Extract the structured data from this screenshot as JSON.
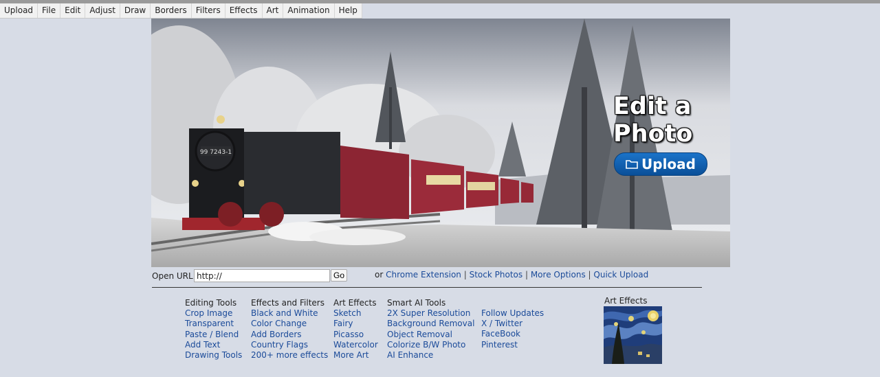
{
  "menu": [
    "Upload",
    "File",
    "Edit",
    "Adjust",
    "Draw",
    "Borders",
    "Filters",
    "Effects",
    "Art",
    "Animation",
    "Help"
  ],
  "hero": {
    "title_line1": "Edit a",
    "title_line2": "Photo",
    "upload_label": "Upload",
    "train_number": "99 7243-1"
  },
  "url": {
    "label": "Open URL:",
    "value": "http://",
    "go_label": "Go",
    "or_text": "or",
    "links": [
      "Chrome Extension",
      "Stock Photos",
      "More Options",
      "Quick Upload"
    ],
    "separator": "|"
  },
  "columns": [
    {
      "heading": "Editing Tools",
      "links": [
        "Crop Image",
        "Transparent",
        "Paste / Blend",
        "Add Text",
        "Drawing Tools"
      ]
    },
    {
      "heading": "Effects and Filters",
      "links": [
        "Black and White",
        "Color Change",
        "Add Borders",
        "Country Flags",
        "200+ more effects"
      ]
    },
    {
      "heading": "Art Effects",
      "links": [
        "Sketch",
        "Fairy",
        "Picasso",
        "Watercolor",
        "More Art"
      ]
    },
    {
      "heading": "Smart AI Tools",
      "links": [
        "2X Super Resolution",
        "Background Removal",
        "Object Removal",
        "Colorize B/W Photo",
        "AI Enhance"
      ]
    },
    {
      "heading": "",
      "links": [
        "Follow Updates",
        "X / Twitter",
        "FaceBook",
        "Pinterest"
      ]
    }
  ],
  "art_effects": {
    "title": "Art Effects"
  },
  "colors": {
    "link": "#1a4a99",
    "upload_button": "#1565b8",
    "background": "#d7dce6"
  }
}
